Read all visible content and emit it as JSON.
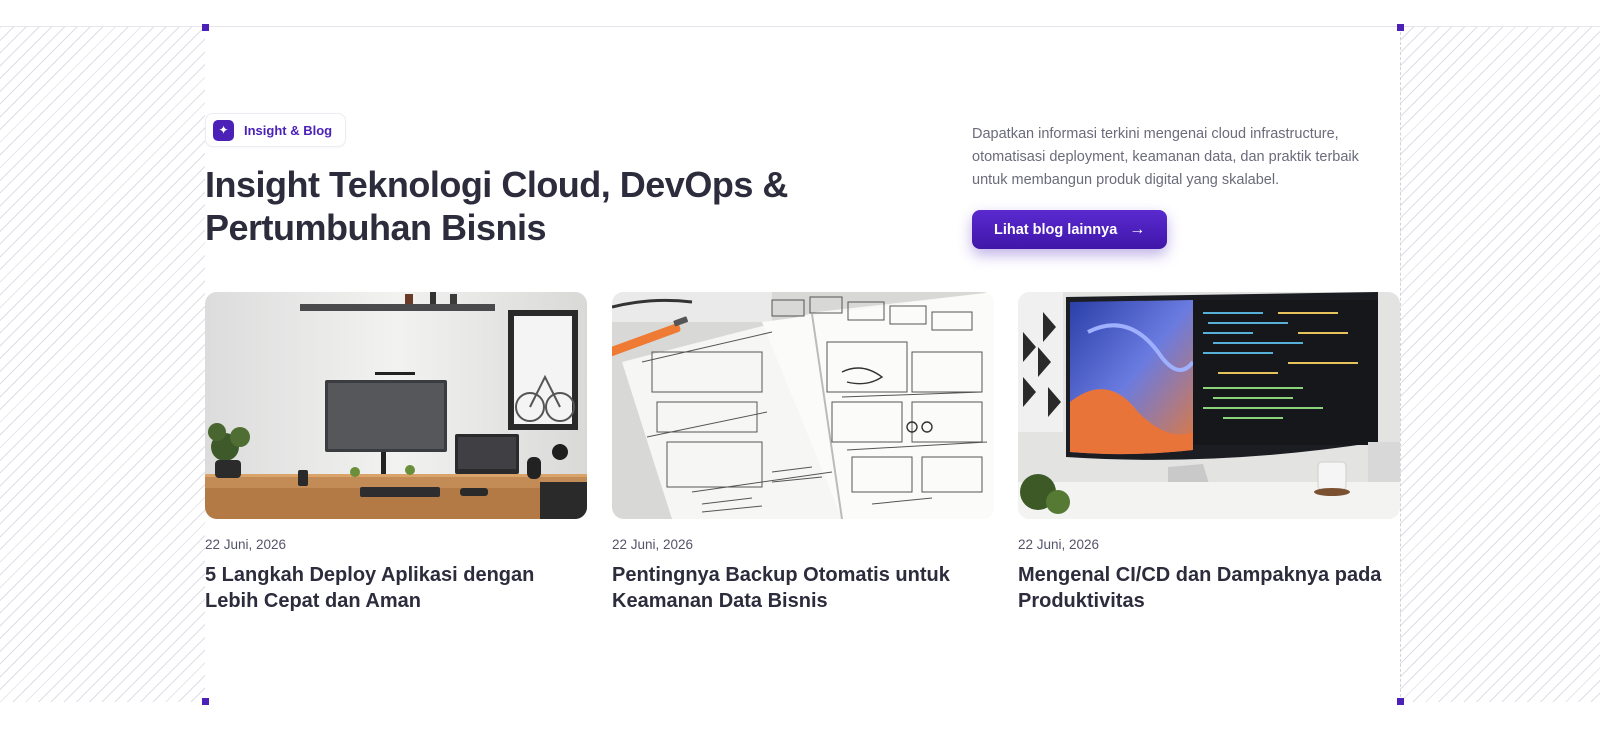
{
  "badge": {
    "icon": "sparkle-icon",
    "label": "Insight & Blog"
  },
  "header": {
    "title": "Insight Teknologi Cloud, DevOps & Pertumbuhan Bisnis",
    "description": "Dapatkan informasi terkini mengenai cloud infrastructure, otomatisasi deployment, keamanan data, dan praktik terbaik untuk membangun produk digital yang skalabel.",
    "cta_label": "Lihat blog lainnya",
    "cta_icon": "arrow-right-icon"
  },
  "colors": {
    "accent": "#4b21b8",
    "text": "#2c2c3c",
    "muted": "#6b6b7b"
  },
  "posts": [
    {
      "date": "22 Juni, 2026",
      "title": "5 Langkah Deploy Aplikasi dengan Lebih Cepat dan Aman",
      "image": "desk-workspace-photo"
    },
    {
      "date": "22 Juni, 2026",
      "title": "Pentingnya Backup Otomatis untuk Keamanan Data Bisnis",
      "image": "wireframe-sketch-photo"
    },
    {
      "date": "22 Juni, 2026",
      "title": "Mengenal CI/CD dan Dampaknya pada Produktivitas",
      "image": "curved-monitor-photo"
    }
  ]
}
